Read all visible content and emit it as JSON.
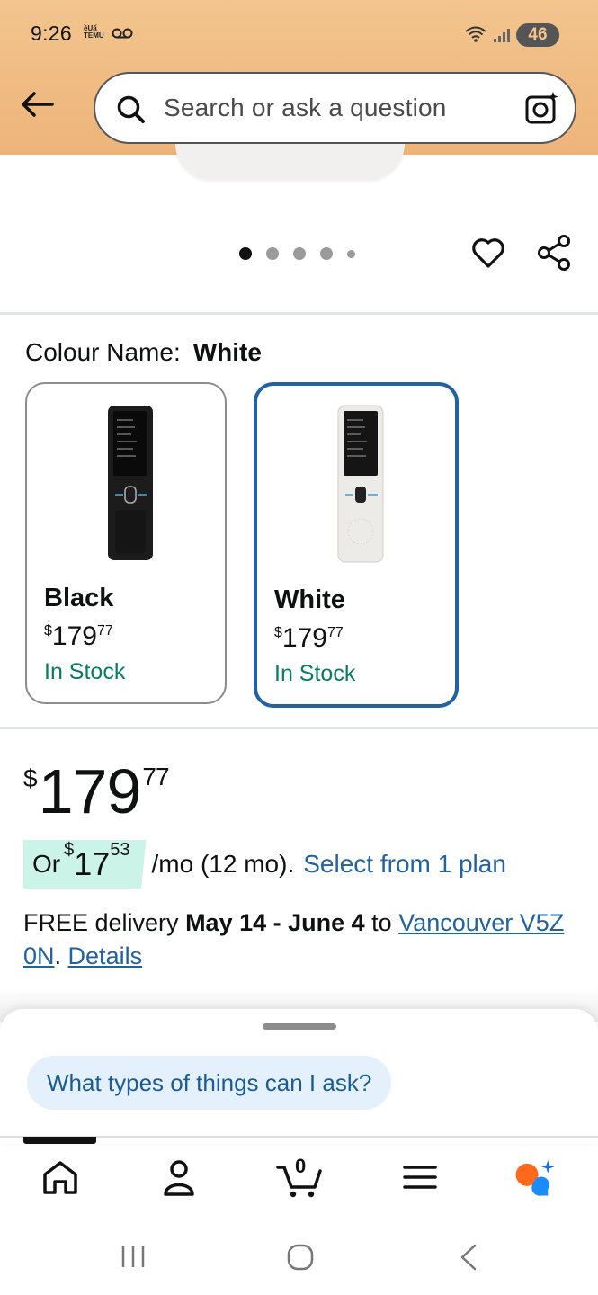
{
  "status_bar": {
    "time": "9:26",
    "notif_line1": "ềUẩ",
    "notif_line2": "TEMU",
    "battery": "46"
  },
  "search": {
    "placeholder": "Search or ask a question"
  },
  "carousel": {
    "total_images": 5,
    "active_index": 0
  },
  "colour": {
    "label": "Colour Name:",
    "selected": "White",
    "options": [
      {
        "name": "Black",
        "price_currency": "$",
        "price_whole": "179",
        "price_fraction": "77",
        "stock": "In Stock"
      },
      {
        "name": "White",
        "price_currency": "$",
        "price_whole": "179",
        "price_fraction": "77",
        "stock": "In Stock"
      }
    ]
  },
  "price": {
    "currency": "$",
    "whole": "179",
    "fraction": "77"
  },
  "installment": {
    "prefix": "Or",
    "currency": "$",
    "whole": "17",
    "fraction": "53",
    "suffix": "/mo (12 mo).",
    "link": "Select from 1 plan"
  },
  "delivery": {
    "prefix": "FREE delivery",
    "dates": "May 14 - June 4",
    "to": "to",
    "location": "Vancouver V5Z 0N",
    "period": ".",
    "details_link": "Details"
  },
  "assistant_sheet": {
    "suggestion": "What types of things can I ask?"
  },
  "bottom_nav": {
    "cart_count": "0",
    "items": [
      "home-icon",
      "account-icon",
      "cart-icon",
      "menu-icon",
      "rufus-icon"
    ]
  },
  "colors": {
    "header_bg": "#f3c48e",
    "link": "#2162a1",
    "in_stock": "#067d62",
    "selected_border": "#2162a1",
    "installment_bg": "#ccf3e8"
  }
}
